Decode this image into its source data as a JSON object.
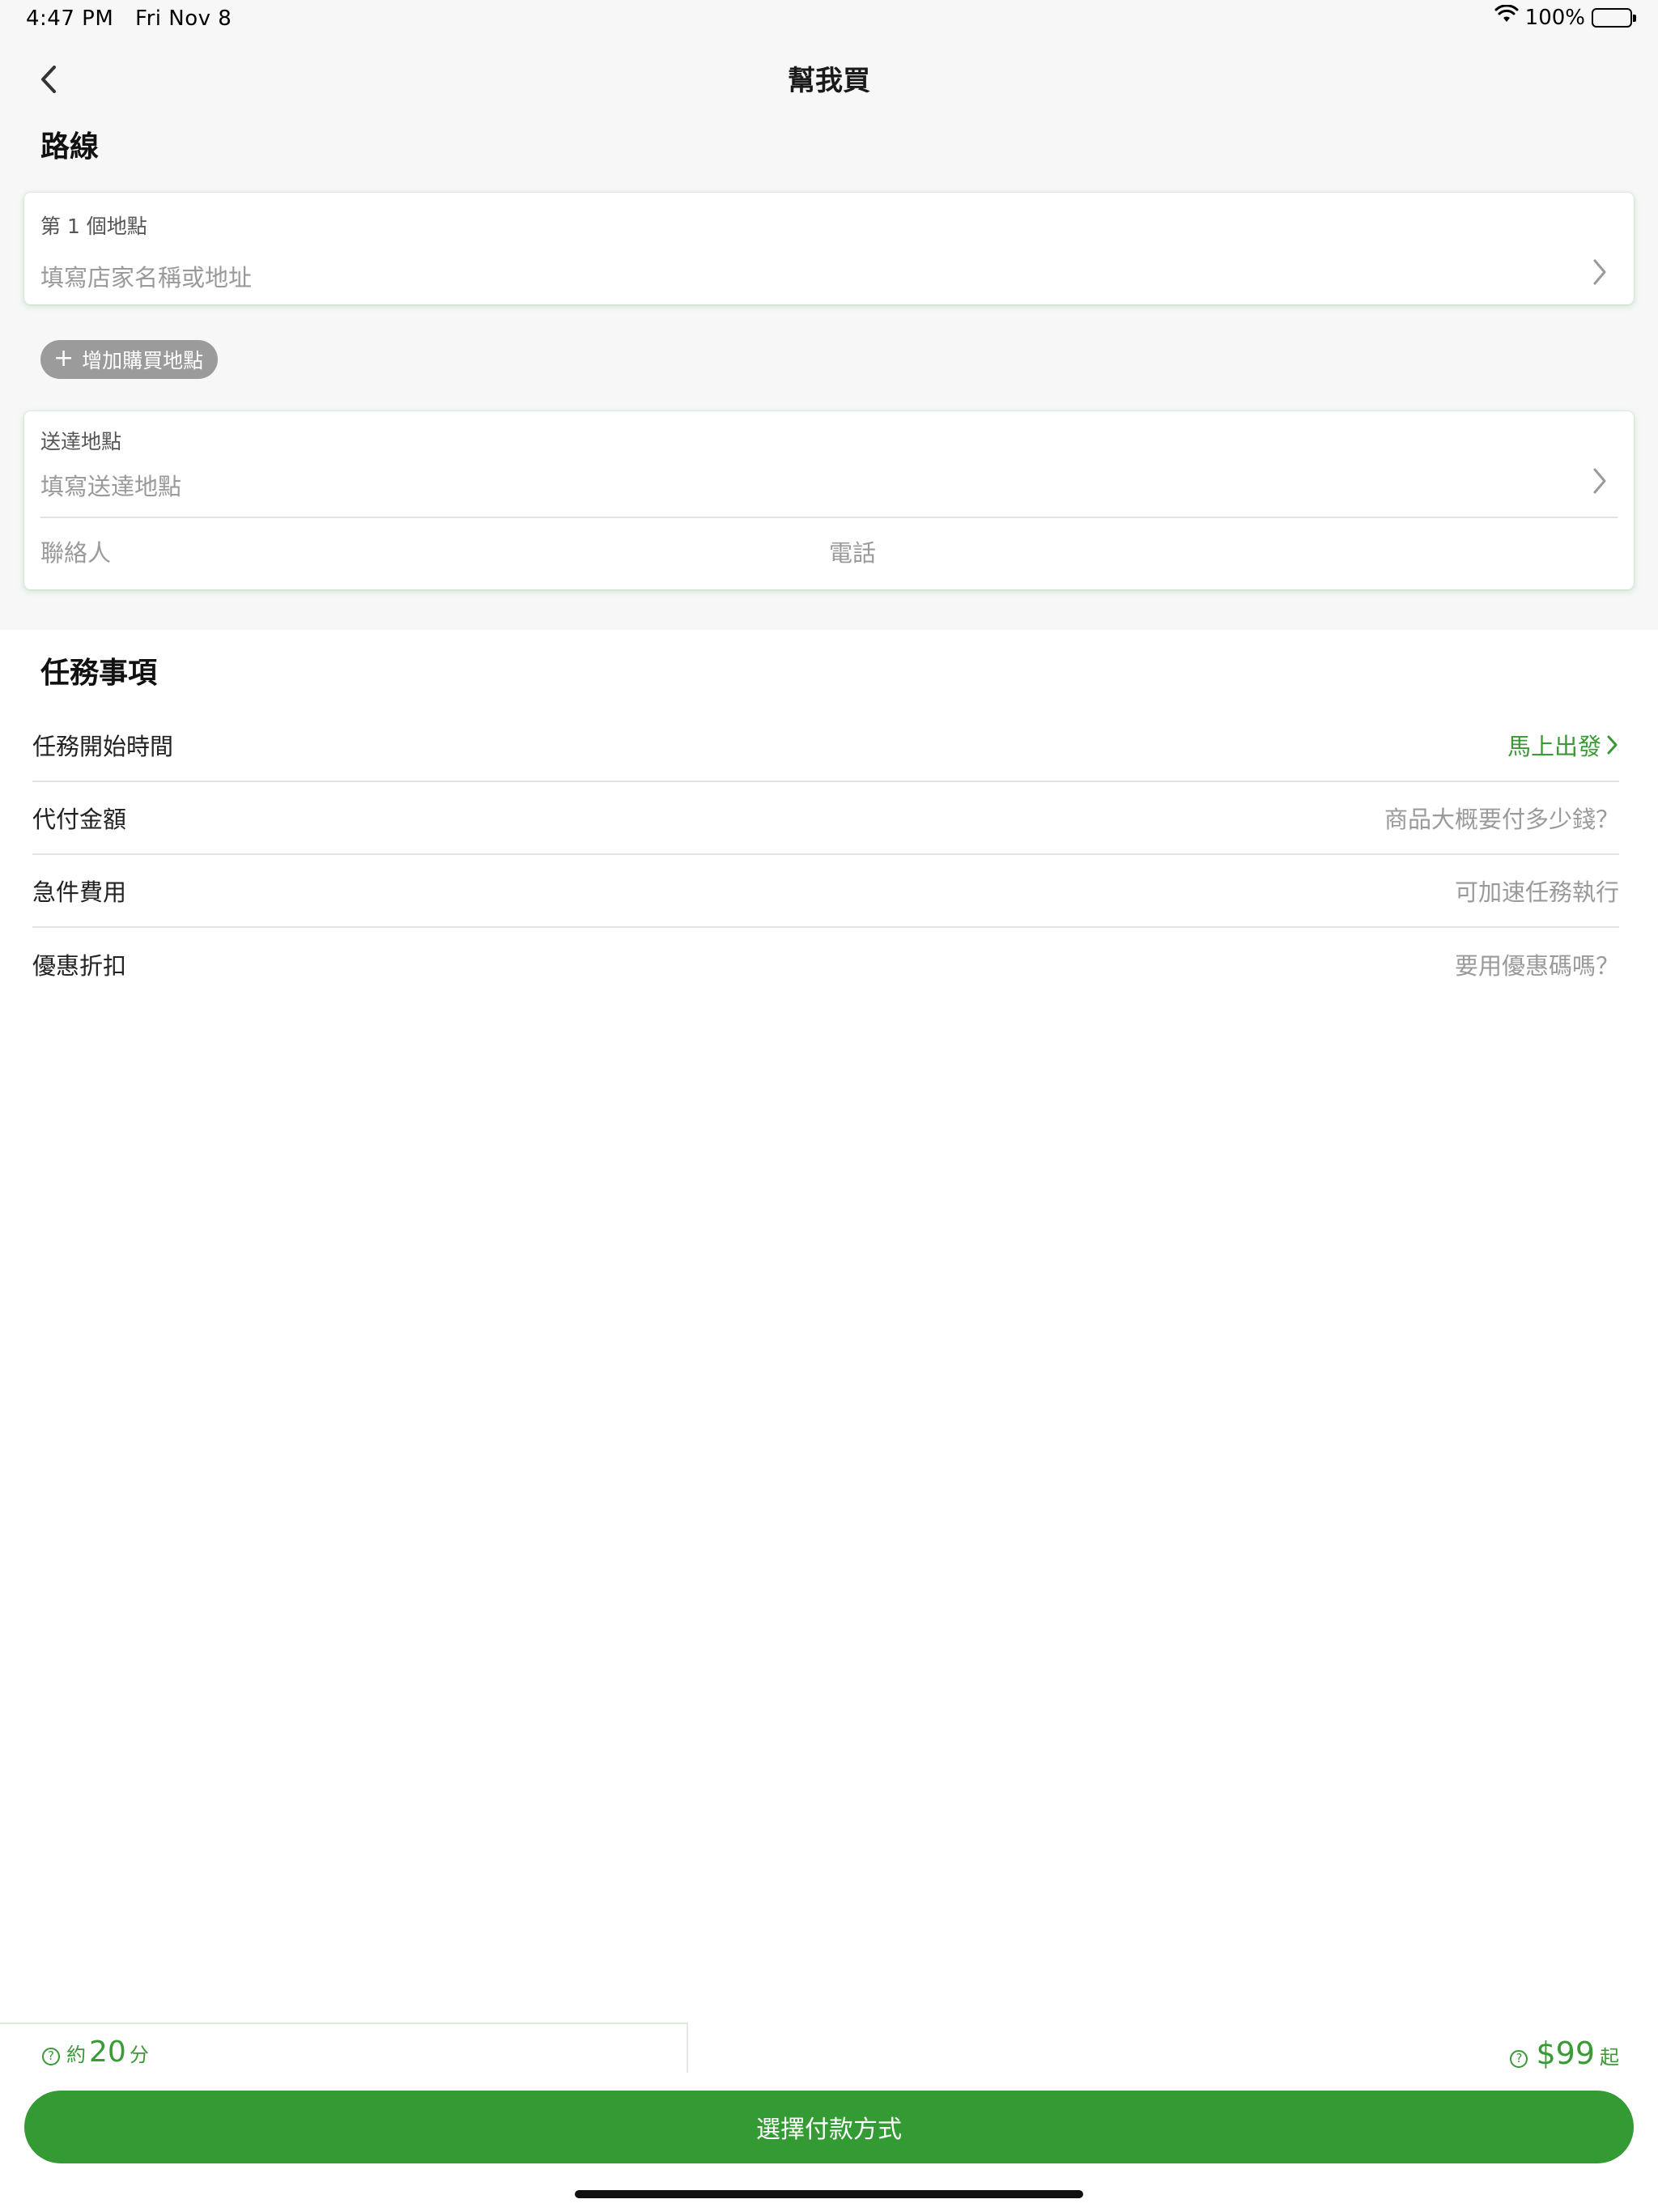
{
  "status_bar": {
    "time": "4:47 PM",
    "date": "Fri Nov 8",
    "battery": "100%"
  },
  "nav": {
    "title": "幫我買"
  },
  "route": {
    "title": "路線",
    "location1": {
      "label": "第 1 個地點",
      "placeholder": "填寫店家名稱或地址"
    },
    "add_button": "增加購買地點",
    "delivery": {
      "label": "送達地點",
      "placeholder": "填寫送達地點",
      "contact_placeholder": "聯絡人",
      "phone_placeholder": "電話"
    }
  },
  "tasks": {
    "title": "任務事項",
    "rows": [
      {
        "label": "任務開始時間",
        "value": "馬上出發"
      },
      {
        "label": "代付金額",
        "value": "商品大概要付多少錢？"
      },
      {
        "label": "急件費用",
        "value": "可加速任務執行"
      },
      {
        "label": "優惠折扣",
        "value": "要用優惠碼嗎？"
      }
    ]
  },
  "bottom": {
    "eta_prefix": "約",
    "eta_value": "20",
    "eta_unit": "分",
    "price": "$99",
    "price_suffix": "起",
    "pay_button": "選擇付款方式"
  },
  "colors": {
    "accent": "#349b34",
    "background": "#f7f7f7"
  }
}
